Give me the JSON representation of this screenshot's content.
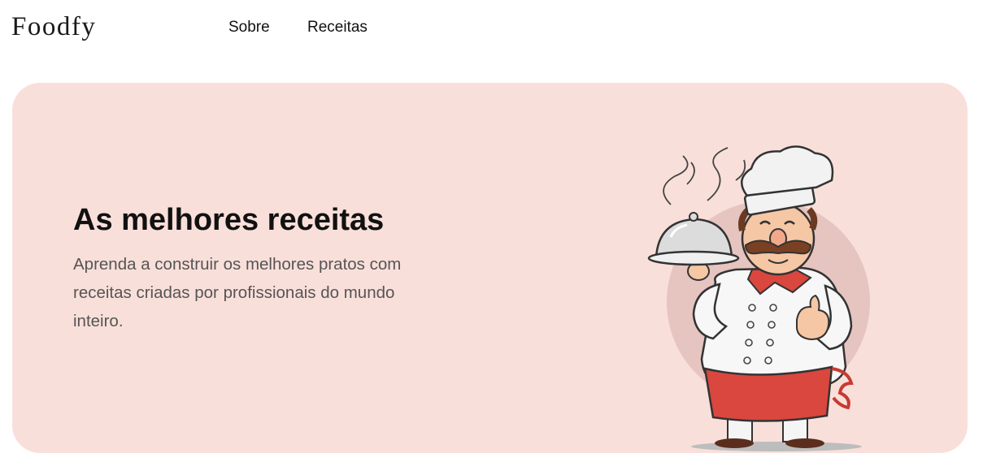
{
  "header": {
    "logo": "Foodfy",
    "nav": [
      {
        "label": "Sobre"
      },
      {
        "label": "Receitas"
      }
    ]
  },
  "hero": {
    "title": "As melhores receitas",
    "description": "Aprenda a construir os melhores pratos com receitas criadas por profissionais do mundo inteiro.",
    "illustration": "chef-illustration"
  },
  "colors": {
    "hero_background": "#f9dfda",
    "apron": "#d9473e",
    "chef_hat": "#f2f2f2"
  }
}
